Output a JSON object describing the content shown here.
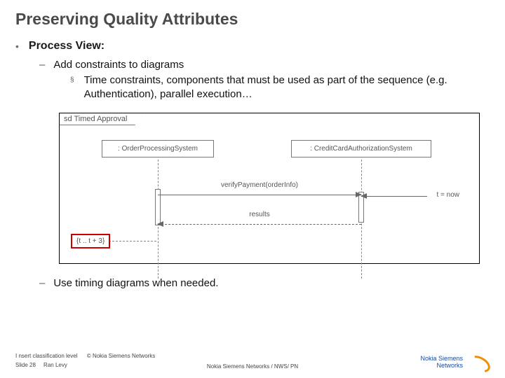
{
  "title": "Preserving Quality Attributes",
  "l1": {
    "bullet": "•",
    "text": "Process View:"
  },
  "l2a": {
    "bullet": "–",
    "text": "Add constraints to diagrams"
  },
  "l3a": {
    "bullet": "§",
    "text": "Time constraints, components that must be used as part of the sequence (e.g. Authentication), parallel execution…"
  },
  "l2b": {
    "bullet": "–",
    "text": "Use timing diagrams when needed."
  },
  "diagram": {
    "frame_label": "sd Timed Approval",
    "lifeline1": ": OrderProcessingSystem",
    "lifeline2": ": CreditCardAuthorizationSystem",
    "msg1": "verifyPayment(orderInfo)",
    "msg2": "results",
    "t_now": "t = now",
    "constraint": "{t .. t + 3}"
  },
  "footer": {
    "classification": "I nsert classification level",
    "copyright": "© Nokia Siemens Networks",
    "slide_no": "Slide 28",
    "author": "Ran Levy",
    "center": "Nokia Siemens Networks / NWS/ PN",
    "logo_line1": "Nokia Siemens",
    "logo_line2": "Networks"
  }
}
